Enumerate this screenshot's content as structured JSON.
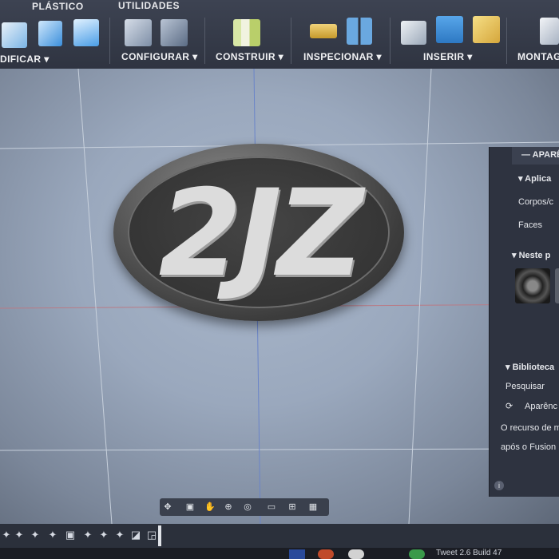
{
  "ribbon": {
    "tabs": [
      "PLÁSTICO",
      "UTILIDADES"
    ],
    "groups": [
      "DIFICAR",
      "CONFIGURAR",
      "CONSTRUIR",
      "INSPECIONAR",
      "INSERIR",
      "MONTAG"
    ],
    "dropdown_glyph": "▾"
  },
  "model": {
    "badge_text": "2JZ"
  },
  "panel": {
    "header": "APARÊ",
    "apply_section": "Aplica",
    "bodies_label": "Corpos/c",
    "faces_label": "Faces",
    "in_this_section": "Neste p",
    "library_section": "Biblioteca",
    "search_label": "Pesquisar",
    "appearance_label": "Aparênc",
    "note_line1": "O recurso de m",
    "note_line2": "após o Fusion",
    "info_glyph": "i"
  },
  "navbar": {
    "icons": [
      "orbit-icon",
      "pan-icon",
      "hand-icon",
      "zoom-icon",
      "view-cube-icon",
      "display-icon",
      "grid-icon",
      "viewports-icon"
    ]
  },
  "taskbar": {
    "title": "Tweet 2.6 Build 47"
  },
  "colors": {
    "ribbon_bg": "#343a47",
    "viewport_bg": "#9aa8bd",
    "panel_bg": "#2e3340",
    "badge_outer": "#3d3d3d",
    "badge_text": "#dcdcdc"
  }
}
